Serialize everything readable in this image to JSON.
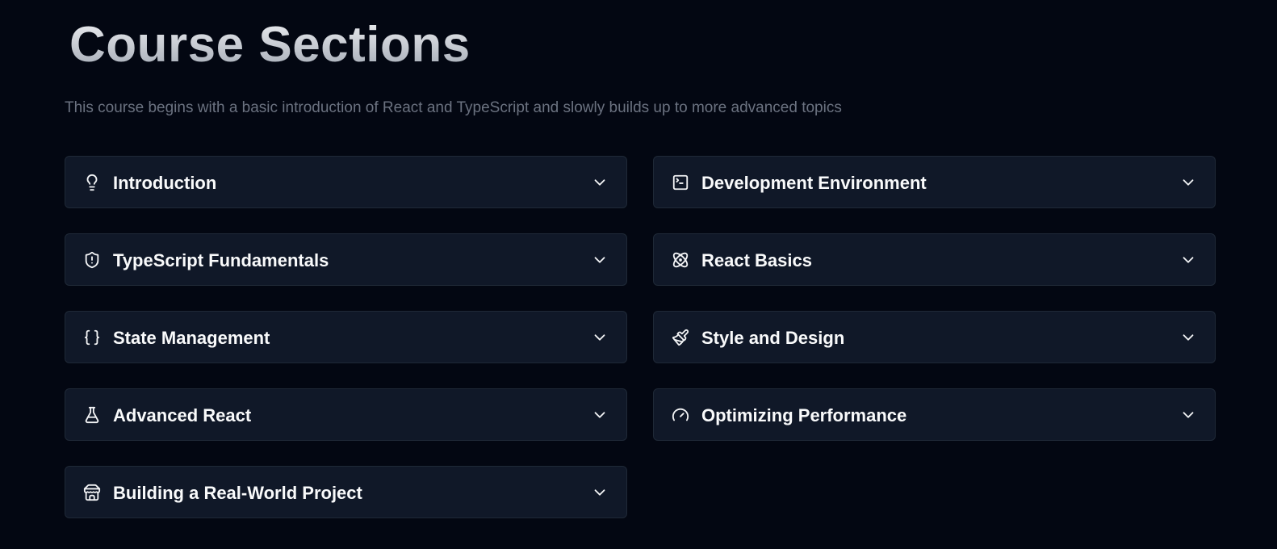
{
  "header": {
    "title": "Course Sections",
    "subtitle": "This course begins with a basic introduction of React and TypeScript and slowly builds up to more advanced topics"
  },
  "sections": [
    {
      "label": "Introduction",
      "icon": "lightbulb-icon",
      "expanded": false
    },
    {
      "label": "Development Environment",
      "icon": "terminal-icon",
      "expanded": false
    },
    {
      "label": "TypeScript Fundamentals",
      "icon": "shield-alert-icon",
      "expanded": false
    },
    {
      "label": "React Basics",
      "icon": "atom-icon",
      "expanded": false
    },
    {
      "label": "State Management",
      "icon": "braces-icon",
      "expanded": false
    },
    {
      "label": "Style and Design",
      "icon": "paintbrush-icon",
      "expanded": false
    },
    {
      "label": "Advanced React",
      "icon": "flask-icon",
      "expanded": false
    },
    {
      "label": "Optimizing Performance",
      "icon": "gauge-icon",
      "expanded": false
    },
    {
      "label": "Building a Real-World Project",
      "icon": "store-icon",
      "expanded": false
    }
  ],
  "colors": {
    "background": "#030712",
    "card_background": "#101828",
    "card_border": "#1f2937",
    "text": "#f9fafb",
    "muted_text": "#6b7280"
  }
}
